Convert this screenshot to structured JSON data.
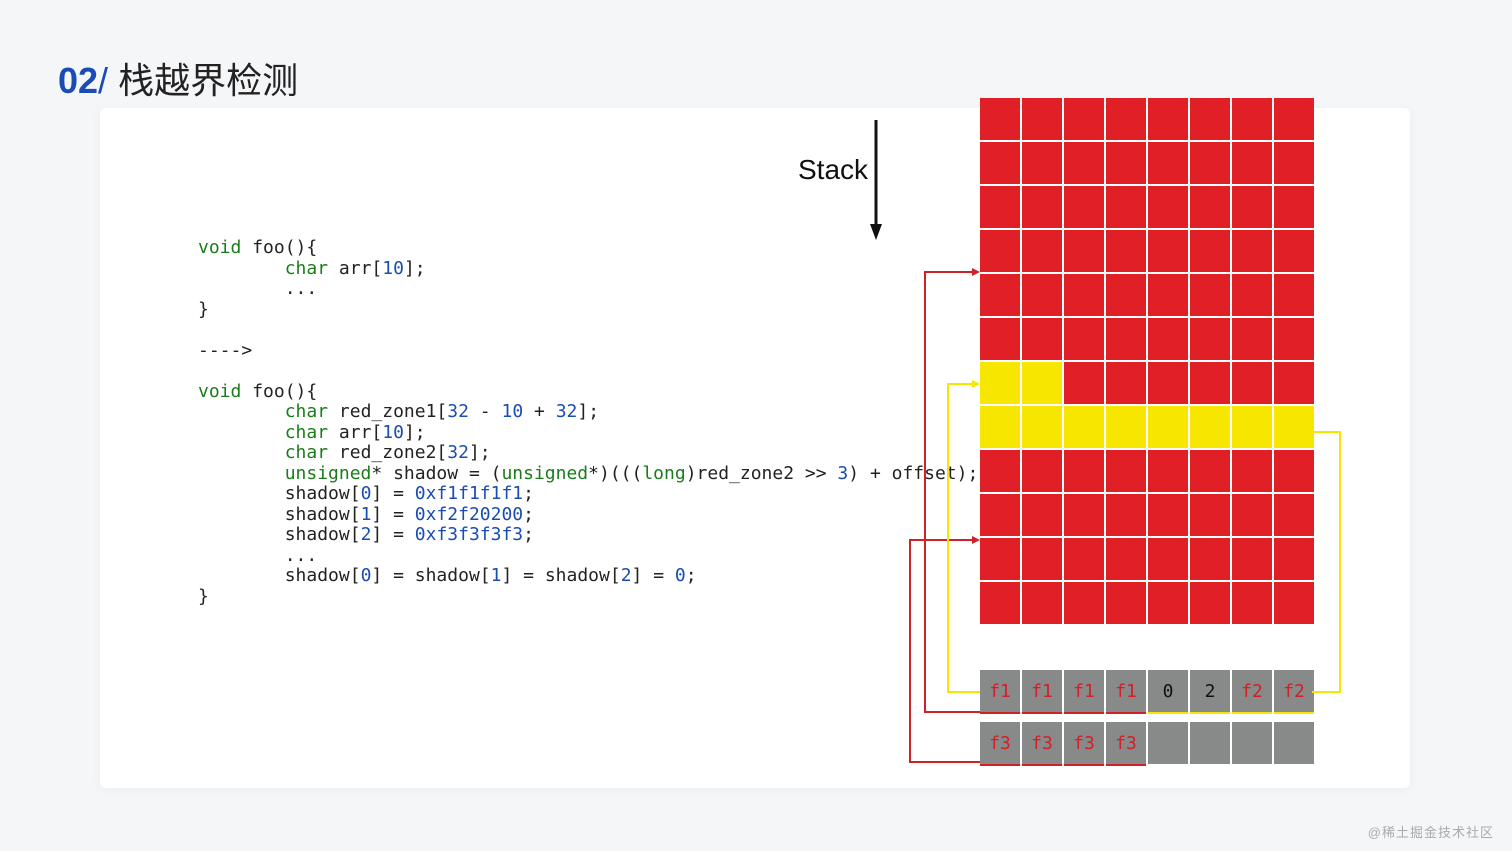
{
  "header": {
    "number": "02",
    "slash": "/",
    "title": "栈越界检测"
  },
  "stack_label": "Stack",
  "code": {
    "l1_void": "void",
    "l1_rest": " foo(){",
    "l2_pad": "        ",
    "l2_char": "char",
    "l2_rest": " arr[",
    "l2_num": "10",
    "l2_end": "];",
    "l3": "        ...",
    "l4": "}",
    "blank1": "",
    "l6": "---->",
    "blank2": "",
    "l8_void": "void",
    "l8_rest": " foo(){",
    "l9_pad": "        ",
    "l9_char": "char",
    "l9_rest": " red_zone1[",
    "l9_n1": "32",
    "l9_m": " - ",
    "l9_n2": "10",
    "l9_p": " + ",
    "l9_n3": "32",
    "l9_end": "];",
    "l10_pad": "        ",
    "l10_char": "char",
    "l10_rest": " arr[",
    "l10_num": "10",
    "l10_end": "];",
    "l11_pad": "        ",
    "l11_char": "char",
    "l11_rest": " red_zone2[",
    "l11_num": "32",
    "l11_end": "];",
    "l12_pad": "        ",
    "l12_unsigned": "unsigned",
    "l12_mid": "* shadow = (",
    "l12_unsigned2": "unsigned",
    "l12_mid2": "*)(((",
    "l12_long": "long",
    "l12_mid3": ")red_zone2 >> ",
    "l12_num": "3",
    "l12_end": ") + offset);",
    "l13_pad": "        ",
    "l13_a": "shadow[",
    "l13_i": "0",
    "l13_b": "] = ",
    "l13_v": "0xf1f1f1f1",
    "l13_e": ";",
    "l14_pad": "        ",
    "l14_a": "shadow[",
    "l14_i": "1",
    "l14_b": "] = ",
    "l14_v": "0xf2f20200",
    "l14_e": ";",
    "l15_pad": "        ",
    "l15_a": "shadow[",
    "l15_i": "2",
    "l15_b": "] = ",
    "l15_v": "0xf3f3f3f3",
    "l15_e": ";",
    "l16": "        ...",
    "l17_pad": "        ",
    "l17_a": "shadow[",
    "l17_i0": "0",
    "l17_b": "] = shadow[",
    "l17_i1": "1",
    "l17_c": "] = shadow[",
    "l17_i2": "2",
    "l17_d": "] = ",
    "l17_z": "0",
    "l17_e": ";",
    "l18": "}"
  },
  "mem_rows": [
    [
      "r",
      "r",
      "r",
      "r",
      "r",
      "r",
      "r",
      "r"
    ],
    [
      "r",
      "r",
      "r",
      "r",
      "r",
      "r",
      "r",
      "r"
    ],
    [
      "r",
      "r",
      "r",
      "r",
      "r",
      "r",
      "r",
      "r"
    ],
    [
      "r",
      "r",
      "r",
      "r",
      "r",
      "r",
      "r",
      "r"
    ],
    [
      "r",
      "r",
      "r",
      "r",
      "r",
      "r",
      "r",
      "r"
    ],
    [
      "r",
      "r",
      "r",
      "r",
      "r",
      "r",
      "r",
      "r"
    ],
    [
      "y",
      "y",
      "r",
      "r",
      "r",
      "r",
      "r",
      "r"
    ],
    [
      "y",
      "y",
      "y",
      "y",
      "y",
      "y",
      "y",
      "y"
    ],
    [
      "r",
      "r",
      "r",
      "r",
      "r",
      "r",
      "r",
      "r"
    ],
    [
      "r",
      "r",
      "r",
      "r",
      "r",
      "r",
      "r",
      "r"
    ],
    [
      "r",
      "r",
      "r",
      "r",
      "r",
      "r",
      "r",
      "r"
    ],
    [
      "r",
      "r",
      "r",
      "r",
      "r",
      "r",
      "r",
      "r"
    ]
  ],
  "shadow_rows": [
    [
      {
        "t": "f1",
        "c": "r",
        "u": "r"
      },
      {
        "t": "f1",
        "c": "r",
        "u": "r"
      },
      {
        "t": "f1",
        "c": "r",
        "u": "r"
      },
      {
        "t": "f1",
        "c": "r",
        "u": "r"
      },
      {
        "t": "0",
        "c": "k",
        "u": "y"
      },
      {
        "t": "2",
        "c": "k",
        "u": "y"
      },
      {
        "t": "f2",
        "c": "r",
        "u": "y"
      },
      {
        "t": "f2",
        "c": "r",
        "u": "y"
      }
    ],
    [
      {
        "t": "f3",
        "c": "r",
        "u": "r"
      },
      {
        "t": "f3",
        "c": "r",
        "u": "r"
      },
      {
        "t": "f3",
        "c": "r",
        "u": "r"
      },
      {
        "t": "f3",
        "c": "r",
        "u": "r"
      },
      {
        "t": "",
        "c": "k",
        "u": ""
      },
      {
        "t": "",
        "c": "k",
        "u": ""
      },
      {
        "t": "",
        "c": "k",
        "u": ""
      },
      {
        "t": "",
        "c": "k",
        "u": ""
      }
    ]
  ],
  "watermark": "@稀土掘金技术社区"
}
